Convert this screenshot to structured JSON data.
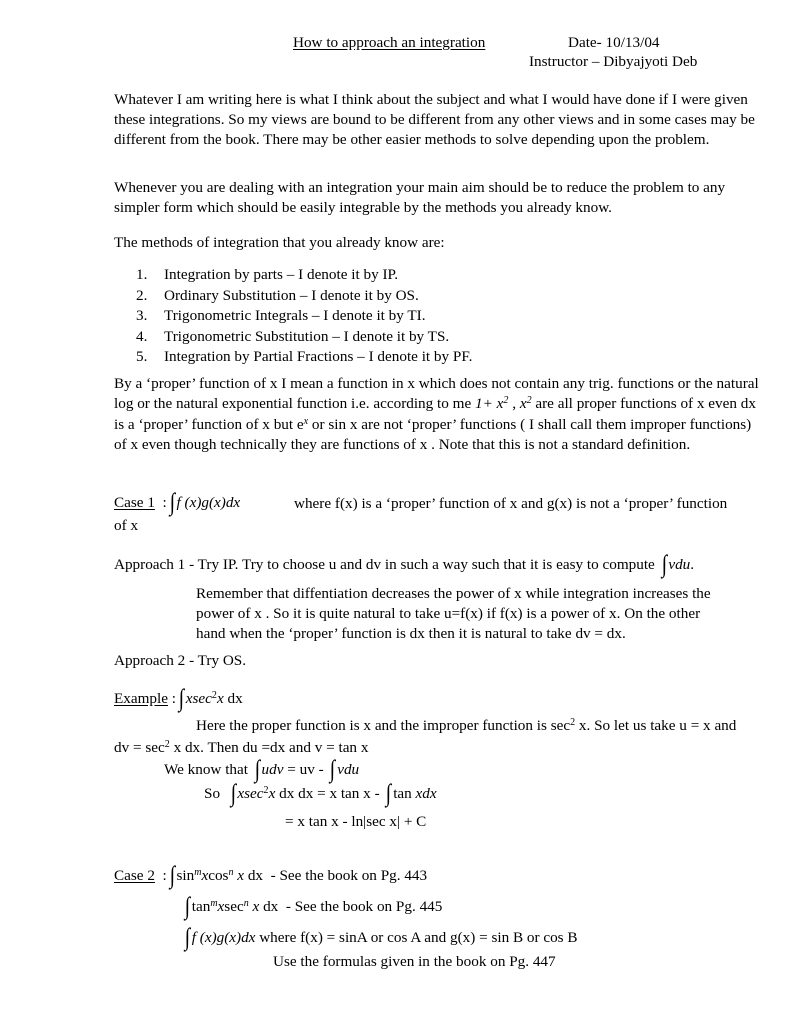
{
  "document": {
    "title": "How to approach an integration",
    "date_line": "Date- 10/13/04",
    "instructor_line": "Instructor – Dibyajyoti Deb",
    "intro_paragraph": "Whatever I am writing here is what I think about the subject and what I would have done if I were given these integrations. So my views are bound to be different from any other views and in some cases may be different from the book. There may be other easier methods to solve depending upon the problem.",
    "aim_paragraph": "Whenever you are dealing with an integration your main aim should be to reduce the problem to any simpler form which should be easily integrable by the methods you already know.",
    "methods_intro": "The methods of integration that you already know are:",
    "methods": [
      {
        "num": "1.",
        "text": "Integration by parts – I denote it by  IP."
      },
      {
        "num": "2.",
        "text": "Ordinary Substitution – I denote it by OS."
      },
      {
        "num": "3.",
        "text": "Trigonometric Integrals – I denote it by TI."
      },
      {
        "num": "4.",
        "text": "Trigonometric Substitution – I denote it by TS."
      },
      {
        "num": "5.",
        "text": "Integration by Partial Fractions – I denote it by PF."
      }
    ],
    "proper_def": {
      "part1": "By a ‘proper’ function of  x  I mean a function in x which does not contain any trig. functions or the natural log or the natural exponential function  i.e. according to me ",
      "expr1_base": "1+ x",
      "expr1_sup": "2",
      "sep": " , ",
      "expr2_base": "x",
      "expr2_sup": "2",
      "part2": "  are all proper functions of x  even dx is a ‘proper’ function of x  but  e",
      "e_sup": "x",
      "part3": " or sin x are not ‘proper’ functions ( I shall call them improper functions) of x even though technically they are functions of x . Note that this is not a standard definition."
    },
    "case1": {
      "label": "Case 1",
      "colon": ":",
      "integral": "∫",
      "integrand": "f (x)g(x)dx",
      "description": "where f(x) is a ‘proper’ function of x  and g(x) is not a ‘proper’ function",
      "continuation": "of x"
    },
    "approach1": {
      "prefix": "Approach 1 -  Try  IP.  Try to choose u and  dv in such a way such that  it  is easy to compute ",
      "integral": "∫",
      "integrand": "vdu",
      "suffix": ".",
      "note_line1": "Remember that diffentiation decreases the power of x while integration increases the",
      "note_line2": "power  of x . So it is quite natural to take u=f(x) if f(x) is a power of x. On the other",
      "note_line3": "hand when the ‘proper’ function is  dx then  it is natural to take dv = dx."
    },
    "approach2": {
      "text": "Approach 2 -  Try OS."
    },
    "example": {
      "label": "Example",
      "colon": ":",
      "integral": "∫",
      "expr_x": "x",
      "expr_sec": "sec",
      "expr_sup": "2",
      "expr_x2": "x",
      "expr_dx": "dx",
      "line_here_a": "Here the proper function is x and the improper function is sec",
      "line_here_sup": "2",
      "line_here_b": " x. So let us take u = x and",
      "line_dv_a": "dv = sec",
      "line_dv_sup": "2",
      "line_dv_b": " x dx. Then  du =dx and v = tan x",
      "we_know_prefix": "We know that ",
      "we_know_udv": "udv",
      "we_know_mid": " = uv - ",
      "we_know_vdu": "vdu",
      "so_prefix": "So ",
      "so_mid": " dx = x tan x  -  ",
      "so_tan": "tan ",
      "so_xdx": "xdx",
      "result_line": "= x tan x  - ln|sec x|  + C"
    },
    "case2": {
      "label": "Case 2",
      "colon": ":",
      "row1": {
        "integral": "∫",
        "sin": "sin",
        "sup_m": "m",
        "x1": "x",
        "cos": "cos",
        "sup_n": "n",
        "x2": " x",
        "dx": " dx",
        "note": "-  See the book on Pg. 443"
      },
      "row2": {
        "integral": "∫",
        "tan": "tan",
        "sup_m": "m",
        "x1": "x",
        "sec": "sec",
        "sup_n": "n",
        "x2": " x",
        "dx": " dx",
        "note": "-  See the book on Pg. 445"
      },
      "row3": {
        "integral": "∫",
        "integrand": "f (x)g(x)dx",
        "note": "where  f(x) = sinA or cos A and g(x) = sin B or cos B"
      },
      "row4": {
        "note": "Use the formulas given in the book on Pg. 447"
      }
    }
  }
}
